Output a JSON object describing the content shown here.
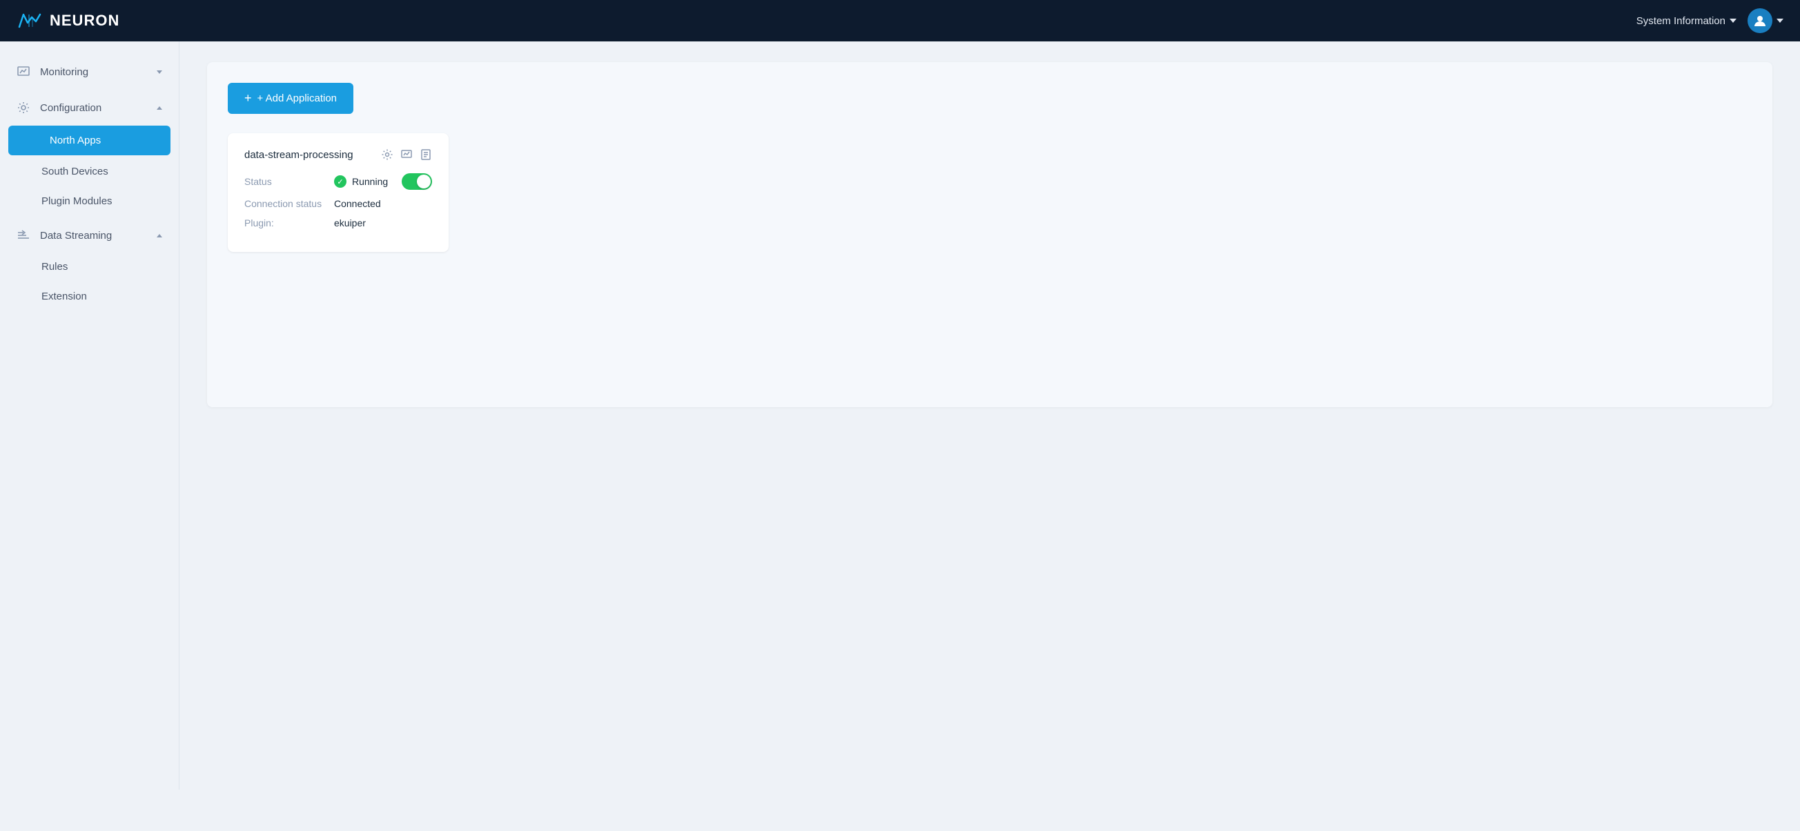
{
  "header": {
    "logo_text": "NEURON",
    "system_info_label": "System Information",
    "user_icon": "person"
  },
  "sidebar": {
    "items": [
      {
        "id": "monitoring",
        "label": "Monitoring",
        "has_icon": true,
        "expanded": false,
        "children": []
      },
      {
        "id": "configuration",
        "label": "Configuration",
        "has_icon": true,
        "expanded": true,
        "children": [
          {
            "id": "north-apps",
            "label": "North Apps",
            "active": true
          },
          {
            "id": "south-devices",
            "label": "South Devices",
            "active": false
          },
          {
            "id": "plugin-modules",
            "label": "Plugin Modules",
            "active": false
          }
        ]
      },
      {
        "id": "data-streaming",
        "label": "Data Streaming",
        "has_icon": true,
        "expanded": true,
        "children": [
          {
            "id": "rules",
            "label": "Rules",
            "active": false
          },
          {
            "id": "extension",
            "label": "Extension",
            "active": false
          }
        ]
      }
    ]
  },
  "main": {
    "add_button_label": "+ Add Application",
    "app_card": {
      "name": "data-stream-processing",
      "status_label": "Status",
      "status_value": "Running",
      "connection_label": "Connection status",
      "connection_value": "Connected",
      "plugin_label": "Plugin:",
      "plugin_value": "ekuiper"
    }
  }
}
